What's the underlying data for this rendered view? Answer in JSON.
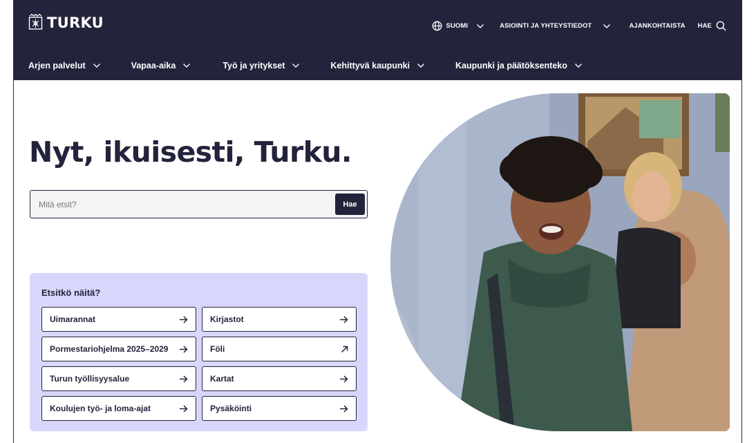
{
  "header": {
    "logo_text": "TURKU",
    "utility": [
      {
        "label": "SUOMI",
        "icon": "globe-icon",
        "dropdown": true
      },
      {
        "label": "ASIOINTI JA YHTEYSTIEDOT",
        "dropdown": true
      },
      {
        "label": "AJANKOHTAISTA"
      },
      {
        "label": "HAE",
        "icon": "search-icon"
      }
    ],
    "nav": [
      {
        "label": "Arjen palvelut"
      },
      {
        "label": "Vapaa-aika"
      },
      {
        "label": "Työ ja yritykset"
      },
      {
        "label": "Kehittyvä kaupunki"
      },
      {
        "label": "Kaupunki ja päätöksenteko"
      }
    ]
  },
  "hero": {
    "title": "Nyt, ikuisesti, Turku.",
    "search": {
      "placeholder": "Mitä etsit?",
      "value": "",
      "button_label": "Hae"
    }
  },
  "suggestions": {
    "title": "Etsitkö näitä?",
    "items": [
      {
        "label": "Uimarannat",
        "icon": "arrow-right-icon"
      },
      {
        "label": "Kirjastot",
        "icon": "arrow-right-icon"
      },
      {
        "label": "Pormestariohjelma 2025–2029",
        "icon": "arrow-right-icon"
      },
      {
        "label": "Föli",
        "icon": "external-arrow-icon"
      },
      {
        "label": "Turun työllisyysalue",
        "icon": "arrow-right-icon"
      },
      {
        "label": "Kartat",
        "icon": "arrow-right-icon"
      },
      {
        "label": "Koulujen työ- ja loma-ajat",
        "icon": "arrow-right-icon"
      },
      {
        "label": "Pysäköinti",
        "icon": "arrow-right-icon"
      }
    ]
  },
  "colors": {
    "header_bg": "#23233b",
    "suggest_bg": "#d8d7fb",
    "text_dark": "#23233b"
  }
}
